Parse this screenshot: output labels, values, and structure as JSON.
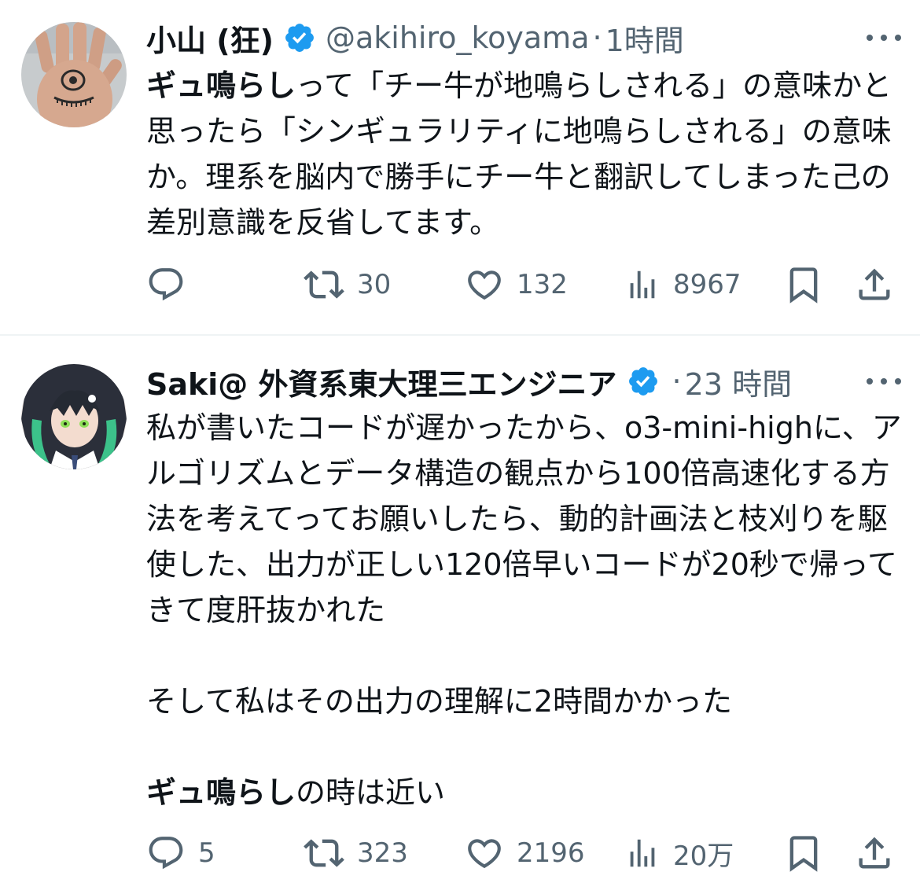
{
  "colors": {
    "verified": "#1d9bf0",
    "muted": "#536471",
    "text": "#0f1419",
    "divider": "#eff3f4"
  },
  "tweets": [
    {
      "display_name": "小山 (狂)",
      "handle": "@akihiro_koyama",
      "separator": "·",
      "time": "1時間",
      "text_parts": [
        {
          "bold": true,
          "text": "ギュ鳴らし"
        },
        {
          "bold": false,
          "text": "って「チー牛が地鳴らしされる」の意味かと思ったら「シンギュラリティに地鳴らしされる」の意味か。理系を脳内で勝手にチー牛と翻訳してしまった己の差別意識を反省してます。"
        }
      ],
      "replies": "",
      "reposts": "30",
      "likes": "132",
      "views": "8967",
      "avatar_icon": "hand-eye-avatar",
      "badge_icon": "verified-badge-icon"
    },
    {
      "display_name": "Saki@ 外資系東大理三エンジニア",
      "handle": "",
      "separator": "·",
      "time": "23 時間",
      "paragraphs": [
        "私が書いたコードが遅かったから、o3-mini-highに、アルゴリズムとデータ構造の観点から100倍高速化する方法を考えてってお願いしたら、動的計画法と枝刈りを駆使した、出力が正しい120倍早いコードが20秒で帰ってきて度肝抜かれた",
        "そして私はその出力の理解に2時間かかった"
      ],
      "last_paragraph": [
        {
          "bold": true,
          "text": "ギュ鳴らし"
        },
        {
          "bold": false,
          "text": "の時は近い"
        }
      ],
      "replies": "5",
      "reposts": "323",
      "likes": "2196",
      "views": "20万",
      "avatar_icon": "anime-girl-avatar",
      "badge_icon": "verified-badge-icon"
    }
  ]
}
